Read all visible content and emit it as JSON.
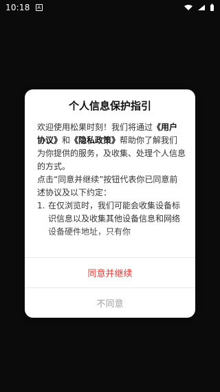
{
  "status_bar": {
    "time": "10:18",
    "app_icon_glyph": "A",
    "wifi_icon": "wifi-icon",
    "signal_icon": "signal-icon",
    "battery_icon": "battery-icon"
  },
  "dialog": {
    "title": "个人信息保护指引",
    "body": {
      "p1_prefix": "欢迎使用松果时刻！我们将通过",
      "agreement_link": "《用户协议》",
      "p1_middle": "和",
      "privacy_link": "《隐私政策》",
      "p1_suffix": "帮助你了解我们为你提供的服务，及收集、处理个人信息的方式。",
      "p2": "点击“同意并继续”按钮代表你已同意前述协议及以下约定：",
      "list_num_1": "1.",
      "list_text_1": "在仅浏览时，我们可能会收集设备标识信息以及收集其他设备信息和网络设备硬件地址，只有你"
    },
    "buttons": {
      "agree": "同意并继续",
      "disagree": "不同意"
    }
  },
  "colors": {
    "accent_red": "#e53935",
    "muted_gray": "#9e9e9e"
  }
}
